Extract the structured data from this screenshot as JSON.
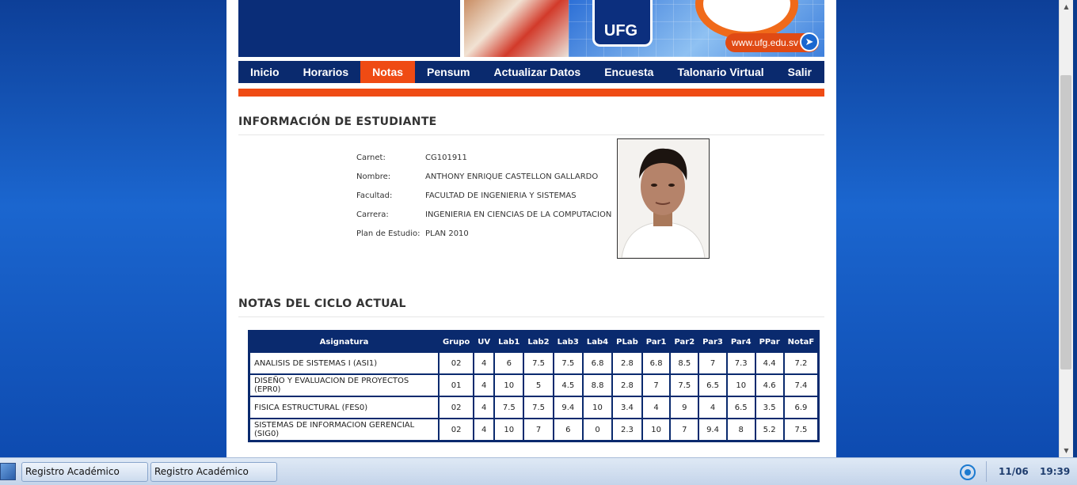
{
  "banner": {
    "logo_text": "UFG",
    "url_text": "www.ufg.edu.sv"
  },
  "nav": {
    "items": [
      "Inicio",
      "Horarios",
      "Notas",
      "Pensum",
      "Actualizar Datos",
      "Encuesta",
      "Talonario Virtual",
      "Salir"
    ],
    "active": "Notas"
  },
  "student": {
    "section_title": "INFORMACIÓN DE ESTUDIANTE",
    "fields": [
      {
        "label": "Carnet:",
        "value": "CG101911"
      },
      {
        "label": "Nombre:",
        "value": "ANTHONY ENRIQUE CASTELLON GALLARDO"
      },
      {
        "label": "Facultad:",
        "value": "FACULTAD DE INGENIERIA Y SISTEMAS"
      },
      {
        "label": "Carrera:",
        "value": "INGENIERIA EN CIENCIAS DE LA COMPUTACION"
      },
      {
        "label": "Plan de Estudio:",
        "value": "PLAN 2010"
      }
    ]
  },
  "grades": {
    "section_title": "NOTAS DEL CICLO ACTUAL",
    "headers": [
      "Asignatura",
      "Grupo",
      "UV",
      "Lab1",
      "Lab2",
      "Lab3",
      "Lab4",
      "PLab",
      "Par1",
      "Par2",
      "Par3",
      "Par4",
      "PPar",
      "NotaF"
    ],
    "rows": [
      [
        "ANALISIS DE SISTEMAS I (ASI1)",
        "02",
        "4",
        "6",
        "7.5",
        "7.5",
        "6.8",
        "2.8",
        "6.8",
        "8.5",
        "7",
        "7.3",
        "4.4",
        "7.2"
      ],
      [
        "DISEÑO Y EVALUACION DE PROYECTOS (EPR0)",
        "01",
        "4",
        "10",
        "5",
        "4.5",
        "8.8",
        "2.8",
        "7",
        "7.5",
        "6.5",
        "10",
        "4.6",
        "7.4"
      ],
      [
        "FISICA ESTRUCTURAL (FES0)",
        "02",
        "4",
        "7.5",
        "7.5",
        "9.4",
        "10",
        "3.4",
        "4",
        "9",
        "4",
        "6.5",
        "3.5",
        "6.9"
      ],
      [
        "SISTEMAS DE INFORMACION GERENCIAL (SIG0)",
        "02",
        "4",
        "10",
        "7",
        "6",
        "0",
        "2.3",
        "10",
        "7",
        "9.4",
        "8",
        "5.2",
        "7.5"
      ]
    ]
  },
  "taskbar": {
    "buttons": [
      "Registro Académico",
      "Registro Académico"
    ],
    "date": "11/06",
    "time": "19:39"
  },
  "colors": {
    "navy": "#0a2a6e",
    "accent_orange": "#ef4b14",
    "page_blue": "#1b66cf"
  }
}
